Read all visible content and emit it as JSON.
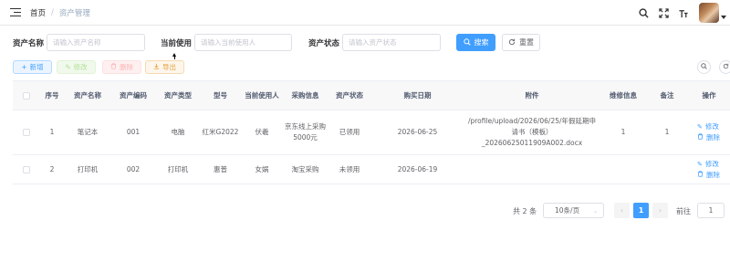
{
  "breadcrumb": {
    "home": "首页",
    "separator": "/",
    "current": "资产管理"
  },
  "navbar": {
    "icons": [
      "search-icon",
      "fullscreen-icon",
      "font-size-icon"
    ]
  },
  "search": {
    "asset_name_label": "资产名称",
    "asset_name_placeholder": "请输入资产名称",
    "current_user_label": "当前使用",
    "current_user_placeholder": "请输入当前使用人",
    "asset_status_label": "资产状态",
    "asset_status_placeholder": "请输入资产状态",
    "search_button": "搜索",
    "reset_button": "重置"
  },
  "toolbar": {
    "add": "新增",
    "edit": "修改",
    "delete": "删除",
    "export": "导出"
  },
  "table": {
    "headers": {
      "index": "序号",
      "name": "资产名称",
      "code": "资产编码",
      "type": "资产类型",
      "model": "型号",
      "user": "当前使用人",
      "purchase": "采购信息",
      "status": "资产状态",
      "purchase_date": "购买日期",
      "attachment": "附件",
      "repair": "维修信息",
      "remark": "备注",
      "action": "操作"
    },
    "rows": [
      {
        "index": "1",
        "name": "笔记本",
        "code": "001",
        "type": "电脑",
        "model": "红米G2022",
        "user": "伏羲",
        "purchase": "京东线上采购5000元",
        "status": "已领用",
        "purchase_date": "2026-06-25",
        "attachment": "/profile/upload/2026/06/25/年假延期申请书（模板）_20260625011909A002.docx",
        "repair": "1",
        "remark": "1",
        "edit": "修改",
        "delete": "删除"
      },
      {
        "index": "2",
        "name": "打印机",
        "code": "002",
        "type": "打印机",
        "model": "惠普",
        "user": "女娲",
        "purchase": "淘宝采购",
        "status": "未领用",
        "purchase_date": "2026-06-19",
        "attachment": "",
        "repair": "",
        "remark": "",
        "edit": "修改",
        "delete": "删除"
      }
    ]
  },
  "pagination": {
    "total": "共 2 条",
    "page_size": "10条/页",
    "current_page": "1",
    "prev": "‹",
    "next": "›",
    "jump_label": "前往",
    "jump_value": "1"
  },
  "colors": {
    "primary": "#409eff",
    "success": "#67c23a",
    "danger": "#f56c6c",
    "warning": "#e6a23c"
  }
}
